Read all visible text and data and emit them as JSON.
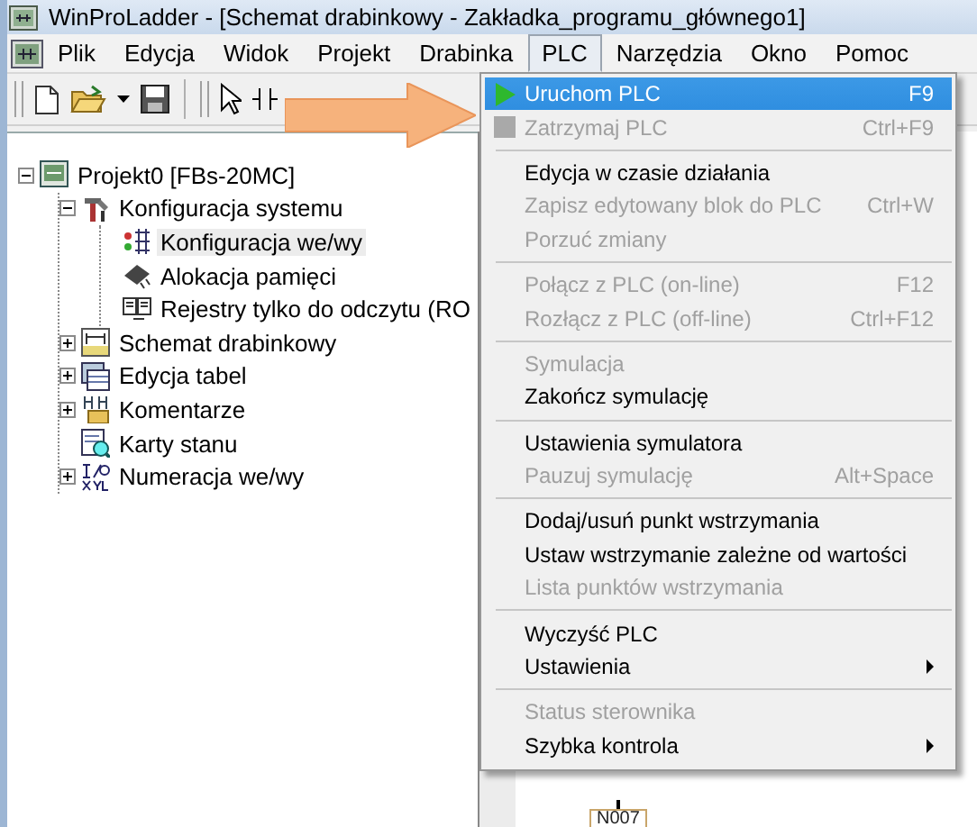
{
  "window": {
    "title": "WinProLadder - [Schemat drabinkowy - Zakładka_programu_głównego1]"
  },
  "menu_bar": [
    {
      "label": "Plik",
      "selected": false
    },
    {
      "label": "Edycja",
      "selected": false
    },
    {
      "label": "Widok",
      "selected": false
    },
    {
      "label": "Projekt",
      "selected": false
    },
    {
      "label": "Drabinka",
      "selected": false
    },
    {
      "label": "PLC",
      "selected": true
    },
    {
      "label": "Narzędzia",
      "selected": false
    },
    {
      "label": "Okno",
      "selected": false
    },
    {
      "label": "Pomoc",
      "selected": false
    }
  ],
  "tree": [
    {
      "label": "Projekt0 [FBs-20MC]",
      "expanded": true,
      "selected": false,
      "children": [
        {
          "label": "Konfiguracja systemu",
          "expanded": true,
          "selected": false,
          "children": [
            {
              "label": "Konfiguracja we/wy",
              "selected": true
            },
            {
              "label": "Alokacja pamięci",
              "selected": false
            },
            {
              "label": "Rejestry tylko do odczytu (RO",
              "selected": false
            }
          ]
        },
        {
          "label": "Schemat drabinkowy",
          "expanded": false,
          "selected": false
        },
        {
          "label": "Edycja tabel",
          "expanded": false,
          "selected": false
        },
        {
          "label": "Komentarze",
          "expanded": false,
          "selected": false
        },
        {
          "label": "Karty stanu",
          "selected": false
        },
        {
          "label": "Numeracja we/wy",
          "expanded": false,
          "selected": false
        }
      ]
    }
  ],
  "plc_menu": [
    {
      "kind": "iconitem",
      "label": "Uruchom PLC",
      "shortcut": "F9",
      "disabled": false,
      "selected": true
    },
    {
      "kind": "iconitem",
      "label": "Zatrzymaj PLC",
      "shortcut": "Ctrl+F9",
      "disabled": true,
      "selected": false
    },
    {
      "kind": "separator"
    },
    {
      "kind": "item",
      "label": "Edycja w czasie działania",
      "disabled": false,
      "selected": false
    },
    {
      "kind": "item",
      "label": "Zapisz edytowany blok do PLC",
      "shortcut": "Ctrl+W",
      "disabled": true,
      "selected": false
    },
    {
      "kind": "item",
      "label": "Porzuć zmiany",
      "disabled": true,
      "selected": false
    },
    {
      "kind": "separator"
    },
    {
      "kind": "item",
      "label": "Połącz z PLC (on-line)",
      "shortcut": "F12",
      "disabled": true,
      "selected": false
    },
    {
      "kind": "item",
      "label": "Rozłącz z PLC (off-line)",
      "shortcut": "Ctrl+F12",
      "disabled": true,
      "selected": false
    },
    {
      "kind": "separator"
    },
    {
      "kind": "item",
      "label": "Symulacja",
      "disabled": true,
      "selected": false
    },
    {
      "kind": "item",
      "label": "Zakończ symulację",
      "disabled": false,
      "selected": false
    },
    {
      "kind": "separator"
    },
    {
      "kind": "item",
      "label": "Ustawienia symulatora",
      "disabled": false,
      "selected": false
    },
    {
      "kind": "item",
      "label": "Pauzuj symulację",
      "shortcut": "Alt+Space",
      "disabled": true,
      "selected": false
    },
    {
      "kind": "separator"
    },
    {
      "kind": "item",
      "label": "Dodaj/usuń punkt wstrzymania",
      "disabled": false,
      "selected": false
    },
    {
      "kind": "item",
      "label": "Ustaw wstrzymanie zależne od wartości",
      "disabled": false,
      "selected": false
    },
    {
      "kind": "item",
      "label": "Lista punktów wstrzymania",
      "disabled": true,
      "selected": false
    },
    {
      "kind": "separator"
    },
    {
      "kind": "item",
      "label": "Wyczyść PLC",
      "disabled": false,
      "selected": false
    },
    {
      "kind": "submenu",
      "label": "Ustawienia",
      "disabled": false,
      "selected": false
    },
    {
      "kind": "separator"
    },
    {
      "kind": "item",
      "label": "Status sterownika",
      "disabled": true,
      "selected": false
    },
    {
      "kind": "submenu",
      "label": "Szybka kontrola",
      "disabled": false,
      "selected": false
    }
  ],
  "ladder": {
    "labels": [
      "N007"
    ]
  }
}
